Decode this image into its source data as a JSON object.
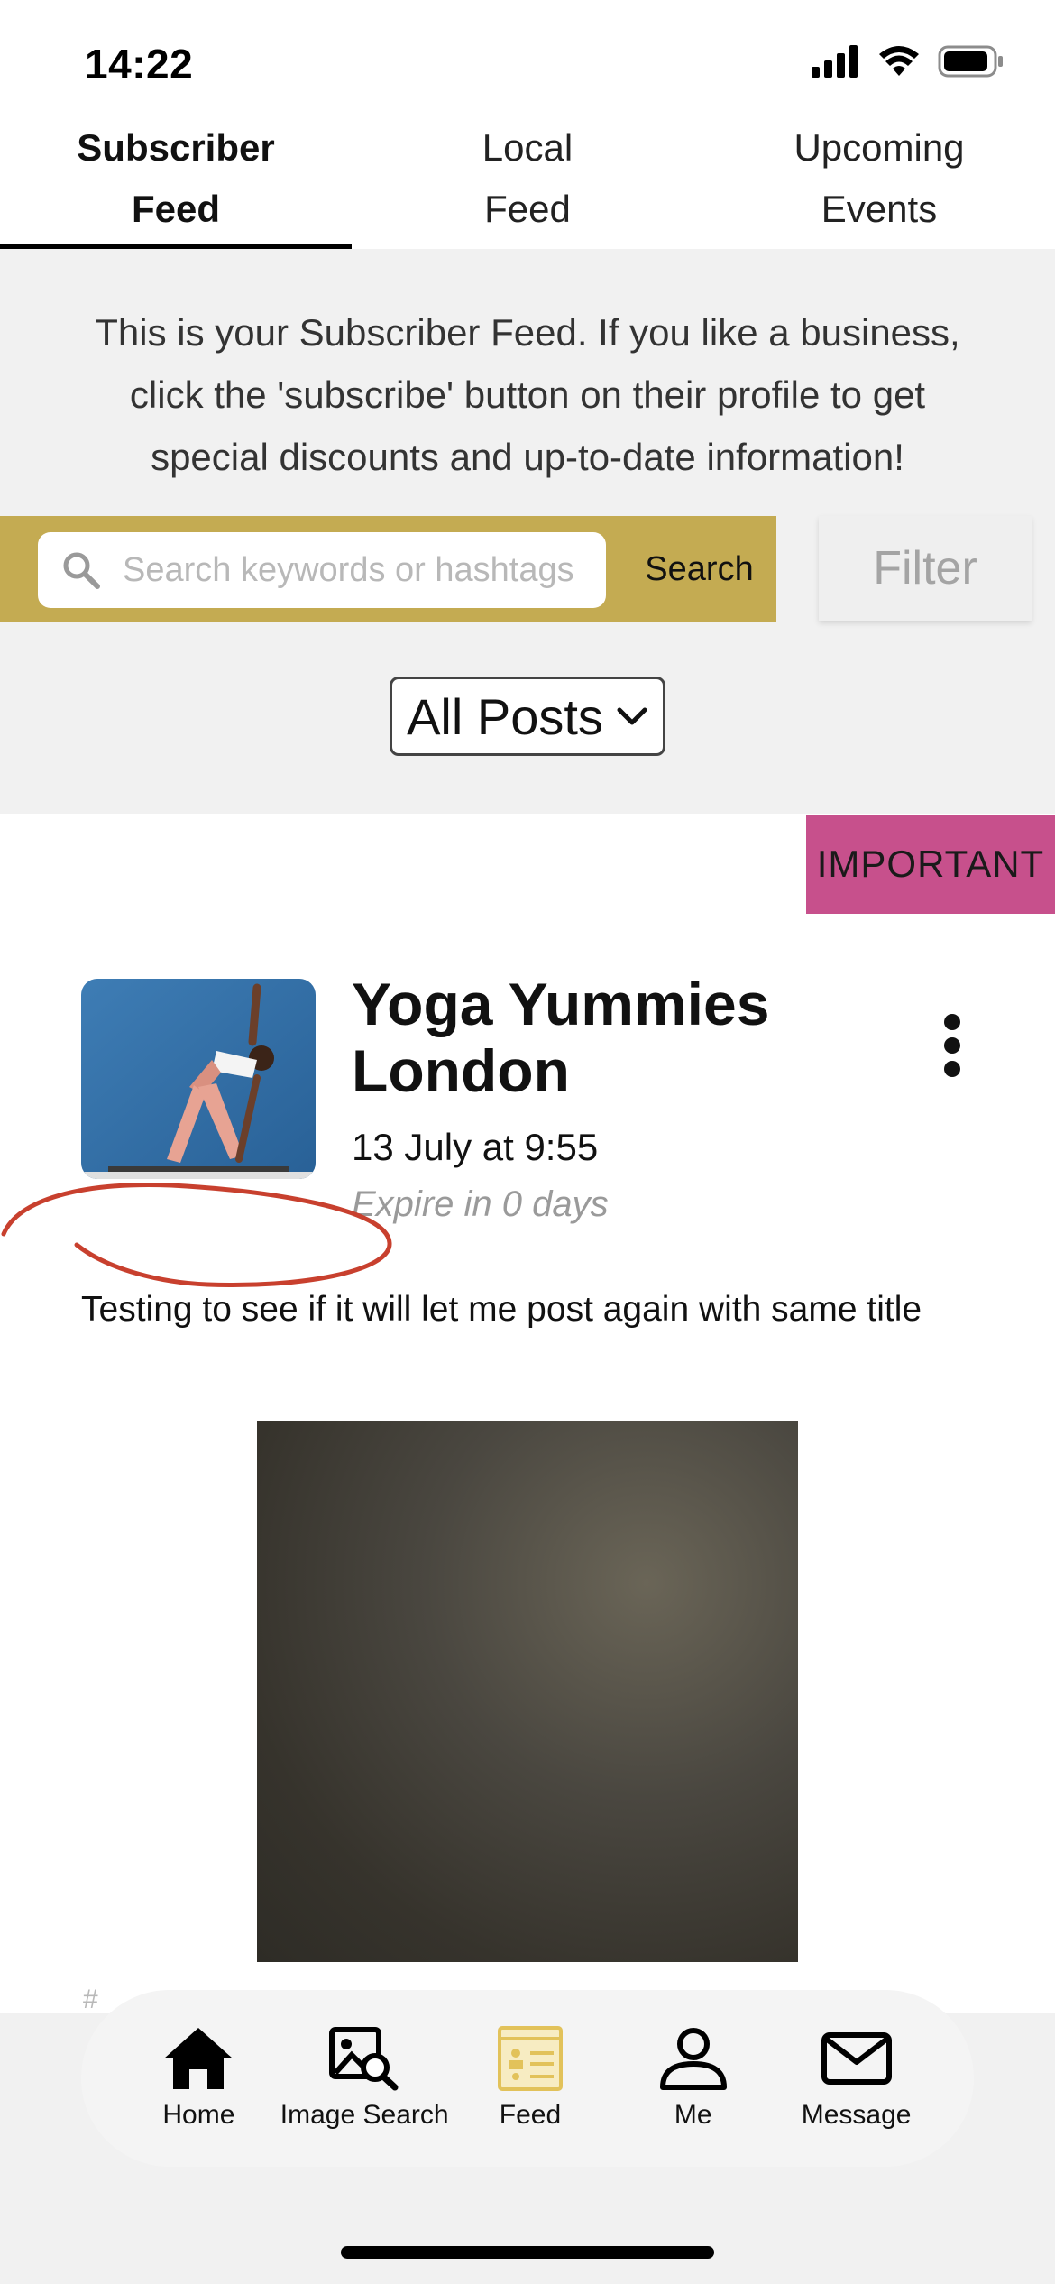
{
  "status_bar": {
    "time": "14:22"
  },
  "tabs": [
    {
      "line1": "Subscriber",
      "line2": "Feed",
      "active": true
    },
    {
      "line1": "Local",
      "line2": "Feed",
      "active": false
    },
    {
      "line1": "Upcoming",
      "line2": "Events",
      "active": false
    }
  ],
  "intro": {
    "line1": "This is your Subscriber Feed. If you like a business,",
    "line2": "click the 'subscribe' button on their profile to get",
    "line3": "special discounts and up-to-date information!"
  },
  "search": {
    "placeholder": "Search keywords or hashtags",
    "button_label": "Search",
    "accent_color": "#c4ab52"
  },
  "filter": {
    "label": "Filter"
  },
  "posts_filter": {
    "selected": "All Posts"
  },
  "post": {
    "badge": "IMPORTANT",
    "badge_color": "#c7508c",
    "title_line1": "Yoga Yummies",
    "title_line2": "London",
    "date": "13 July at 9:55",
    "expire": "Expire in 0 days",
    "body": "Testing to see if it will let me post again with same title",
    "hashtag_fragment": "#"
  },
  "nav": [
    {
      "label": "Home",
      "icon": "home-icon"
    },
    {
      "label": "Image Search",
      "icon": "image-search-icon"
    },
    {
      "label": "Feed",
      "icon": "feed-icon"
    },
    {
      "label": "Me",
      "icon": "person-icon"
    },
    {
      "label": "Message",
      "icon": "mail-icon"
    }
  ]
}
